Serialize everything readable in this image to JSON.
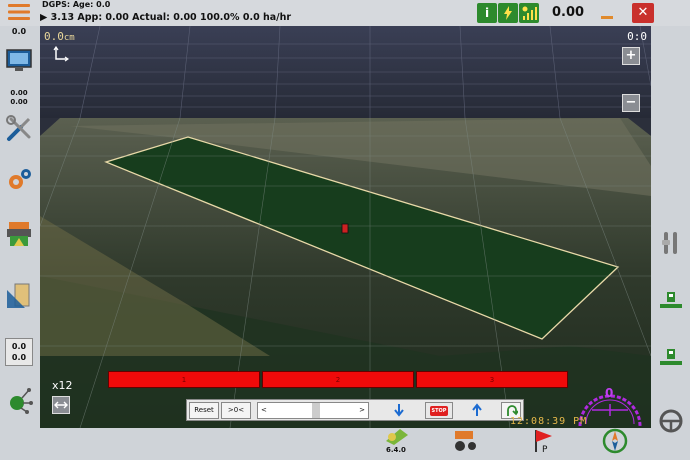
{
  "topbar": {
    "dgps": "DGPS: Age: 0.0",
    "status": "▶ 3.13  App: 0.00  Actual: 0.00  100.0%  0.0 ha/hr",
    "speed": "0.00"
  },
  "leftbar": {
    "top_value": "0.0",
    "value2_top": "0.00",
    "value2_bottom": "0.00",
    "box_value1": "0.0",
    "box_value2": "0.0"
  },
  "map": {
    "offset": "0.0",
    "offset_unit": "cm",
    "offset_right": "0:0",
    "zoom": "x12",
    "sections": [
      "1",
      "2",
      "3"
    ]
  },
  "toolbar": {
    "reset": "Reset",
    "center": ">0<",
    "stop": "STOP",
    "scroll_left": "<",
    "scroll_right": ">"
  },
  "gauge": {
    "value": "0"
  },
  "clock": "12:08:39 PM",
  "version": "6.4.0",
  "colors": {
    "field_green": "#173d1d",
    "section_red": "#f00a0a",
    "clock_amber": "#e6b84b",
    "gauge_purple": "#b02ae0"
  }
}
